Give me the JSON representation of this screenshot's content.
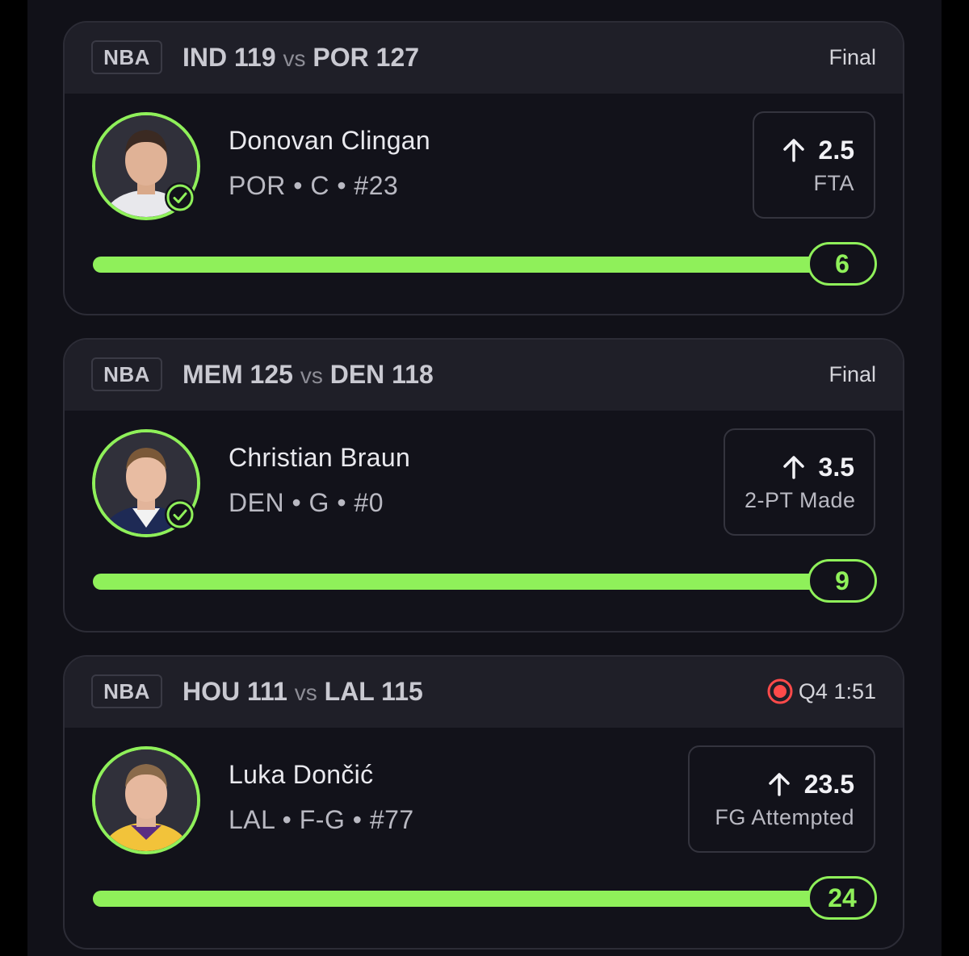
{
  "colors": {
    "accent_green": "#8ff05a",
    "live_red": "#ff4a4a",
    "card_bg": "#12121a",
    "header_bg": "#1f1f28"
  },
  "cards": [
    {
      "league": "NBA",
      "away_team": "IND",
      "away_score": "119",
      "vs": "vs",
      "home_team": "POR",
      "home_score": "127",
      "status": "Final",
      "is_live": false,
      "player_name": "Donovan Clingan",
      "player_meta": "POR • C • #23",
      "hit": true,
      "line": "2.5",
      "direction_icon": "arrow-up-icon",
      "stat": "FTA",
      "result": "6",
      "progress": 1.0
    },
    {
      "league": "NBA",
      "away_team": "MEM",
      "away_score": "125",
      "vs": "vs",
      "home_team": "DEN",
      "home_score": "118",
      "status": "Final",
      "is_live": false,
      "player_name": "Christian Braun",
      "player_meta": "DEN • G • #0",
      "hit": true,
      "line": "3.5",
      "direction_icon": "arrow-up-icon",
      "stat": "2-PT Made",
      "result": "9",
      "progress": 1.0
    },
    {
      "league": "NBA",
      "away_team": "HOU",
      "away_score": "111",
      "vs": "vs",
      "home_team": "LAL",
      "home_score": "115",
      "status": "Q4 1:51",
      "is_live": true,
      "player_name": "Luka Dončić",
      "player_meta": "LAL • F-G • #77",
      "hit": false,
      "line": "23.5",
      "direction_icon": "arrow-up-icon",
      "stat": "FG Attempted",
      "result": "24",
      "progress": 1.0
    }
  ]
}
